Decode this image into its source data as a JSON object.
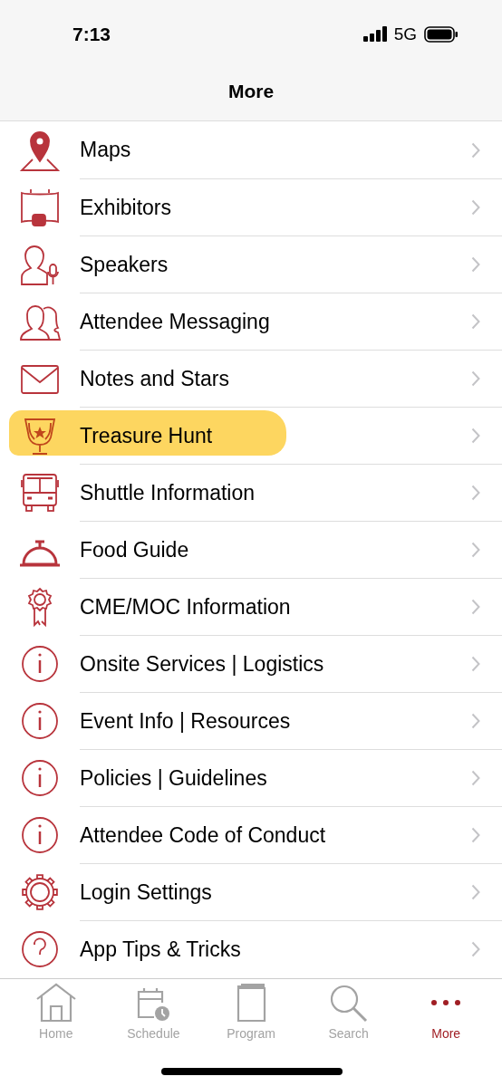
{
  "status_bar": {
    "time": "7:13",
    "network": "5G"
  },
  "nav_bar": {
    "title": "More"
  },
  "menu": [
    {
      "label": "Maps",
      "highlighted": false
    },
    {
      "label": "Exhibitors",
      "highlighted": false
    },
    {
      "label": "Speakers",
      "highlighted": false
    },
    {
      "label": "Attendee Messaging",
      "highlighted": false
    },
    {
      "label": "Notes and Stars",
      "highlighted": false
    },
    {
      "label": "Treasure Hunt",
      "highlighted": true
    },
    {
      "label": "Shuttle Information",
      "highlighted": false
    },
    {
      "label": "Food Guide",
      "highlighted": false
    },
    {
      "label": "CME/MOC Information",
      "highlighted": false
    },
    {
      "label": "Onsite Services | Logistics",
      "highlighted": false
    },
    {
      "label": "Event Info | Resources",
      "highlighted": false
    },
    {
      "label": "Policies | Guidelines",
      "highlighted": false
    },
    {
      "label": "Attendee Code of Conduct",
      "highlighted": false
    },
    {
      "label": "Login Settings",
      "highlighted": false
    },
    {
      "label": "App Tips & Tricks",
      "highlighted": false
    }
  ],
  "tab_bar": [
    {
      "label": "Home",
      "selected": false
    },
    {
      "label": "Schedule",
      "selected": false
    },
    {
      "label": "Program",
      "selected": false
    },
    {
      "label": "Search",
      "selected": false
    },
    {
      "label": "More",
      "selected": true
    }
  ]
}
